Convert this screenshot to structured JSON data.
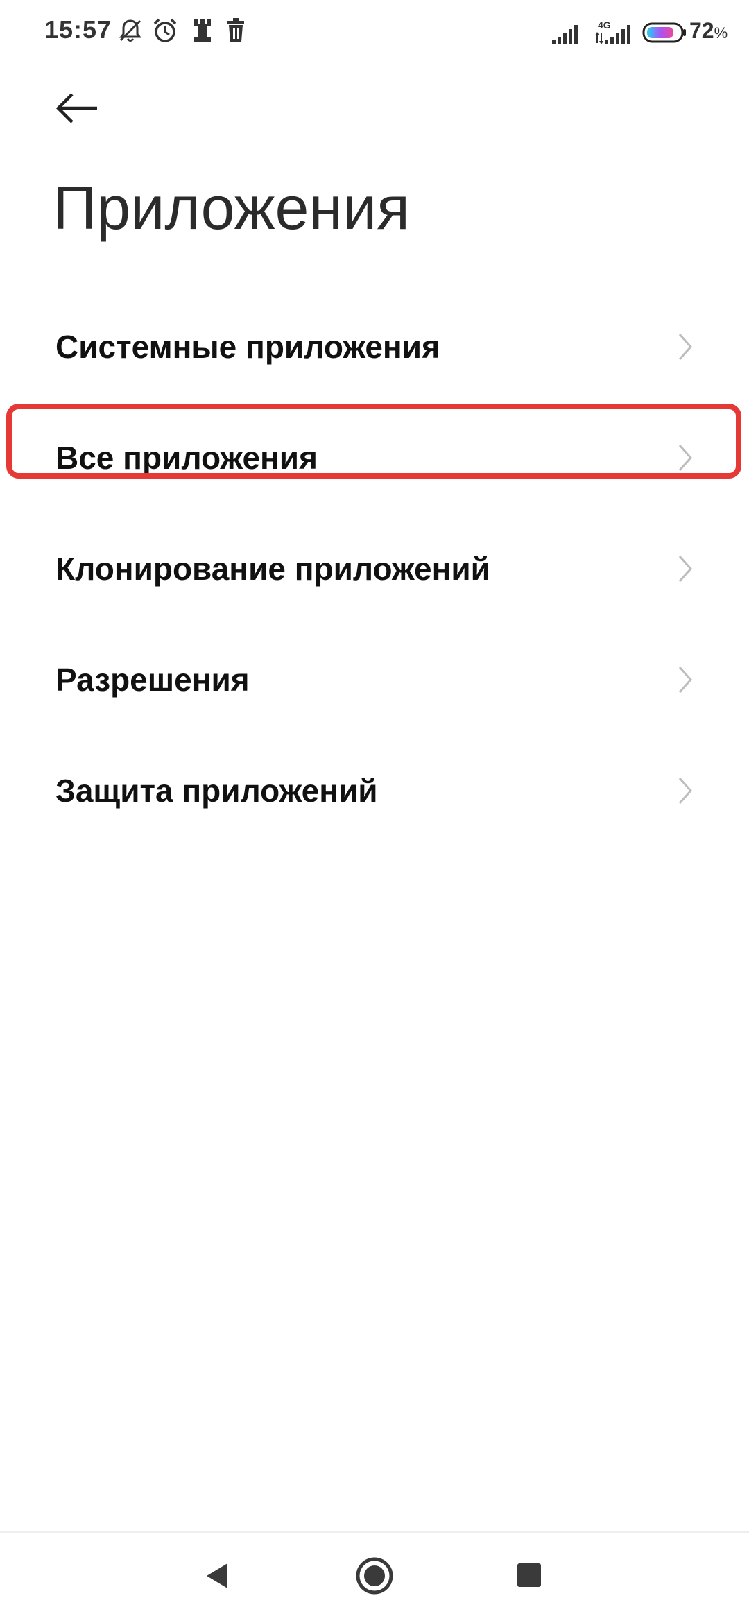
{
  "status_bar": {
    "time": "15:57",
    "network_type": "4G",
    "battery_percent": "72",
    "battery_unit": "%",
    "icons": [
      "mute-notifications-icon",
      "alarm-icon",
      "rook-icon",
      "trash-icon",
      "signal-icon",
      "signal-4g-icon",
      "battery-icon"
    ]
  },
  "header": {
    "back_icon": "arrow-left-icon",
    "title": "Приложения"
  },
  "menu": {
    "items": [
      {
        "label": "Системные приложения"
      },
      {
        "label": "Все приложения",
        "highlighted": true
      },
      {
        "label": "Клонирование приложений"
      },
      {
        "label": "Разрешения"
      },
      {
        "label": "Защита приложений"
      }
    ]
  },
  "colors": {
    "highlight": "#e53935",
    "chevron": "#bdbdbd",
    "text": "#111111",
    "nav": "#3a3a3a"
  },
  "nav_bar": {
    "icons": [
      "back-triangle-icon",
      "home-circle-icon",
      "recents-square-icon"
    ]
  }
}
